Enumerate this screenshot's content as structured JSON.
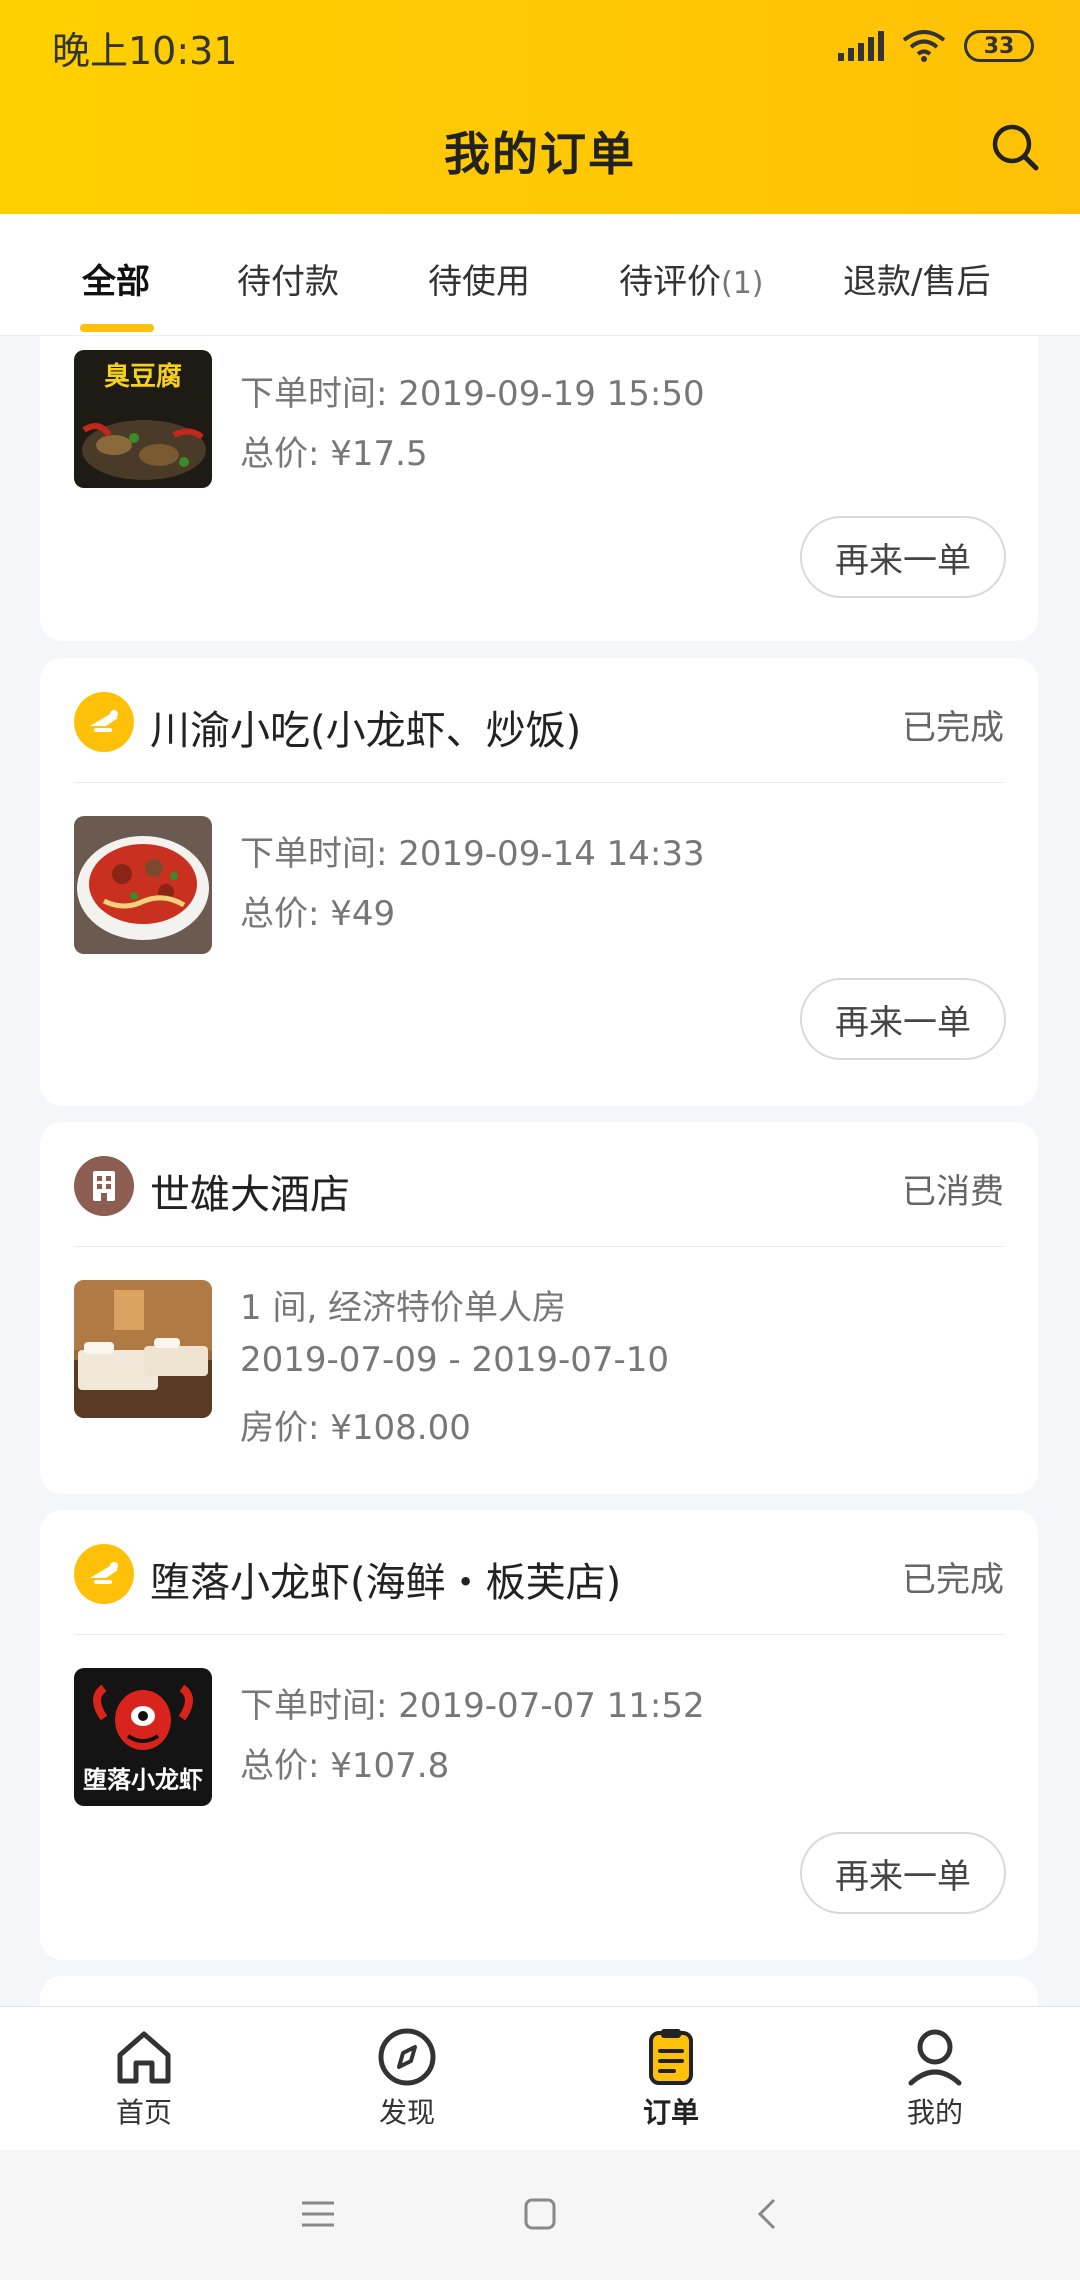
{
  "status_bar": {
    "time": "晚上10:31",
    "battery": "33"
  },
  "header": {
    "title": "我的订单"
  },
  "tabs": [
    {
      "label": "全部",
      "count": ""
    },
    {
      "label": "待付款",
      "count": ""
    },
    {
      "label": "待使用",
      "count": ""
    },
    {
      "label": "待评价",
      "count": "(1)"
    },
    {
      "label": "退款/售后",
      "count": ""
    }
  ],
  "orders": [
    {
      "shop": "",
      "status": "",
      "lines": [
        "下单时间: 2019-09-19 15:50",
        "总价: ¥17.5"
      ],
      "thumb_text": "臭豆腐",
      "button": "再来一单"
    },
    {
      "shop": "川渝小吃(小龙虾、炒饭)",
      "status": "已完成",
      "lines": [
        "下单时间: 2019-09-14 14:33",
        "总价: ¥49"
      ],
      "button": "再来一单"
    },
    {
      "shop": "世雄大酒店",
      "status": "已消费",
      "lines": [
        "1 间, 经济特价单人房",
        "2019-07-09 - 2019-07-10",
        "房价: ¥108.00"
      ]
    },
    {
      "shop": "堕落小龙虾(海鲜・板芙店)",
      "status": "已完成",
      "lines": [
        "下单时间: 2019-07-07 11:52",
        "总价: ¥107.8"
      ],
      "thumb_text": "堕落小龙虾",
      "button": "再来一单"
    }
  ],
  "bottom_nav": [
    {
      "label": "首页",
      "icon": "home-icon"
    },
    {
      "label": "发现",
      "icon": "compass-icon"
    },
    {
      "label": "订单",
      "icon": "order-icon",
      "active": true
    },
    {
      "label": "我的",
      "icon": "user-icon"
    }
  ],
  "colors": {
    "accent": "#ffc107",
    "hotel_icon": "#8c5d51"
  }
}
